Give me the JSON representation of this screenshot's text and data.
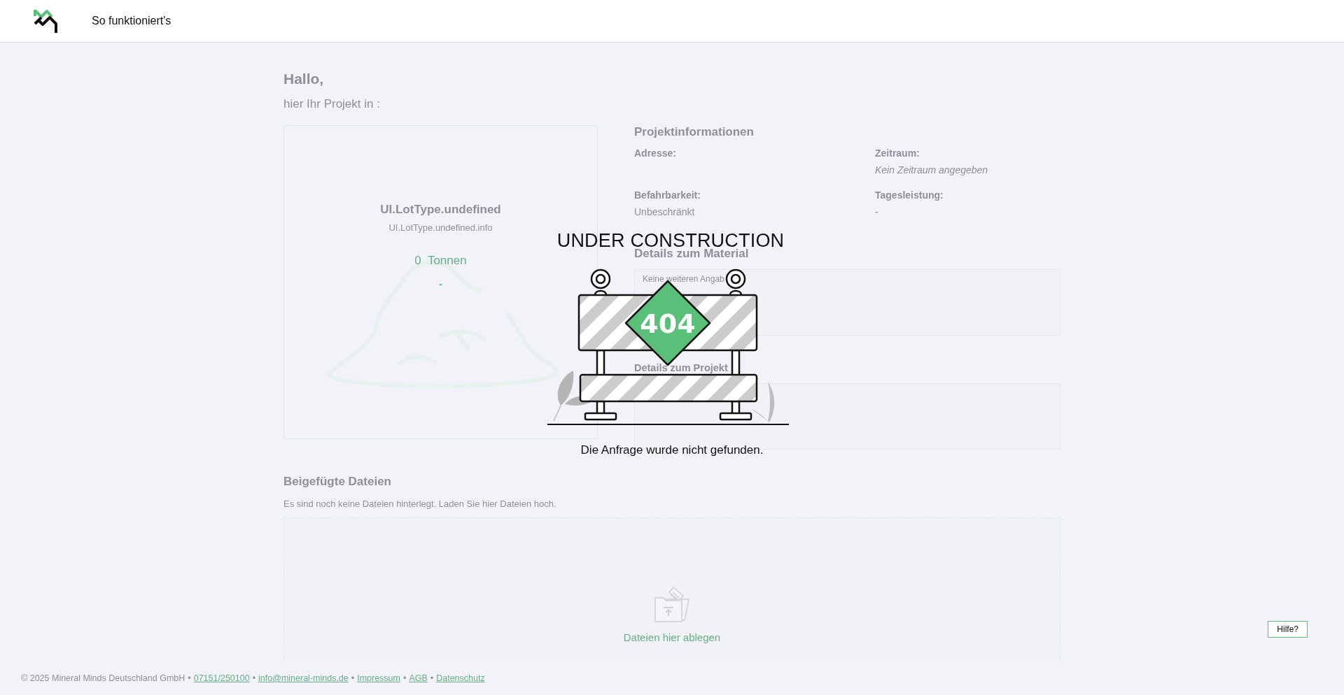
{
  "header": {
    "nav_link": "So funktioniert's"
  },
  "greeting": {
    "title": "Hallo,",
    "subtitle": "hier Ihr Projekt in  :"
  },
  "lot_card": {
    "type": "UI.LotType.undefined",
    "info": "UI.LotType.undefined.info",
    "amount": "0",
    "unit": "Tonnen",
    "note": "-"
  },
  "project_info": {
    "title": "Projektinformationen",
    "fields": [
      {
        "label": "Adresse:"
      },
      {
        "label": "Zeitraum:",
        "value": "Kein Zeitraum angegeben",
        "kind": "empty"
      },
      {
        "label": "Befahrbarkeit:",
        "value": "Unbeschränkt",
        "kind": "plain"
      },
      {
        "label": "Tagesleistung:",
        "value": "-",
        "kind": "plain"
      }
    ]
  },
  "material": {
    "title": "Details zum Material",
    "text": "Keine weiteren Angab"
  },
  "project_details": {
    "title": "Details zum Projekt"
  },
  "files": {
    "title": "Beigefügte Dateien",
    "description": "Es sind noch keine Dateien hinterlegt. Laden Sie hier Dateien hoch.",
    "drop_label": "Dateien hier ablegen"
  },
  "overlay": {
    "title": "UNDER CONSTRUCTION",
    "code": "404",
    "message": "Die Anfrage wurde nicht gefunden."
  },
  "footer": {
    "copyright": "© 2025 Mineral Minds Deutschland GmbH",
    "separator": "•",
    "links": [
      "07151/250100",
      "info@mineral-minds.de",
      "Impressum",
      "AGB",
      "Datenschutz"
    ]
  },
  "help_button": "Hilfe?"
}
